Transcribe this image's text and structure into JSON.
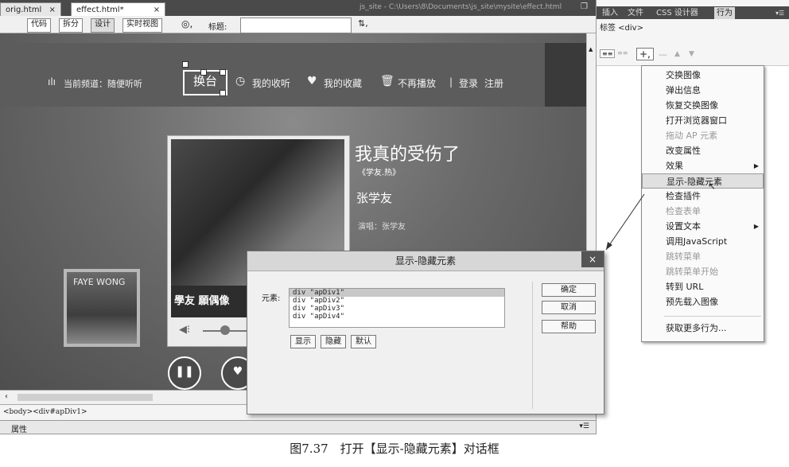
{
  "doc_tabs": [
    {
      "label": "orig.html",
      "close": "×"
    },
    {
      "label": "effect.html*",
      "close": "×"
    }
  ],
  "window": {
    "path": "js_site - C:\\Users\\8\\Documents\\js_site\\mysite\\effect.html",
    "restore_icon": "restore-window-icon"
  },
  "toolbar": {
    "code": "代码",
    "split": "拆分",
    "design": "设计",
    "live_view": "实时视图",
    "title_label": "标题:",
    "title_value": ""
  },
  "page": {
    "nav": {
      "channel": "当前频道：随便听听",
      "switch": "换台",
      "my_listen": "我的收听",
      "my_favorites": "我的收藏",
      "no_play": "不再播放",
      "separator": "|",
      "login": "登录",
      "register": "注册"
    },
    "song": {
      "title": "我真的受伤了",
      "album": "《学友.热》",
      "artist": "张学友",
      "singer_line": "演唱：张学友"
    },
    "cover_band_text": "學友 願偶像",
    "small_cover_text": "FAYE WONG"
  },
  "status": {
    "tag_path": "<body><div#apDiv1>",
    "properties": "属性"
  },
  "panel": {
    "tabs": [
      "插入",
      "文件",
      "CSS 设计器",
      "行为"
    ],
    "active_tab": "行为",
    "tag_label": "标签 <div>",
    "add_button": "+,",
    "remove_button": "—"
  },
  "behaviors_menu": {
    "items": [
      {
        "label": "交换图像",
        "enabled": true
      },
      {
        "label": "弹出信息",
        "enabled": true
      },
      {
        "label": "恢复交换图像",
        "enabled": true
      },
      {
        "label": "打开浏览器窗口",
        "enabled": true
      },
      {
        "label": "拖动 AP 元素",
        "enabled": false
      },
      {
        "label": "改变属性",
        "enabled": true
      },
      {
        "label": "效果",
        "enabled": true,
        "submenu": true
      },
      {
        "label": "显示-隐藏元素",
        "enabled": true,
        "highlighted": true
      },
      {
        "label": "检查插件",
        "enabled": true
      },
      {
        "label": "检查表单",
        "enabled": false
      },
      {
        "label": "设置文本",
        "enabled": true,
        "submenu": true
      },
      {
        "label": "调用JavaScript",
        "enabled": true
      },
      {
        "label": "跳转菜单",
        "enabled": false
      },
      {
        "label": "跳转菜单开始",
        "enabled": false
      },
      {
        "label": "转到 URL",
        "enabled": true
      },
      {
        "label": "预先载入图像",
        "enabled": true
      },
      {
        "label": "获取更多行为...",
        "enabled": true
      }
    ]
  },
  "dialog": {
    "title": "显示-隐藏元素",
    "close": "×",
    "element_label": "元素:",
    "elements": [
      "div \"apDiv1\"",
      "div \"apDiv2\"",
      "div \"apDiv3\"",
      "div \"apDiv4\""
    ],
    "selected_index": 0,
    "show": "显示",
    "hide": "隐藏",
    "default": "默认",
    "ok": "确定",
    "cancel": "取消",
    "help": "帮助"
  },
  "caption": "图7.37　打开【显示-隐藏元素】对话框"
}
